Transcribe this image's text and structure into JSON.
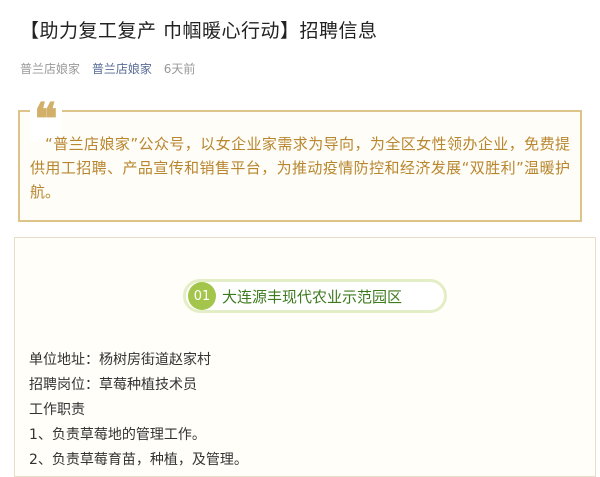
{
  "article": {
    "title": "【助力复工复产 巾帼暖心行动】招聘信息",
    "meta": {
      "author": "普兰店娘家",
      "account": "普兰店娘家",
      "time": "6天前"
    }
  },
  "quote": {
    "mark": "❝",
    "text": "“普兰店娘家”公众号，以女企业家需求为导向，为全区女性领办企业，免费提供用工招聘、产品宣传和销售平台，为推动疫情防控和经济发展“双胜利”温暖护航。"
  },
  "section": {
    "number": "01",
    "name": "大连源丰现代农业示范园区",
    "lines": [
      "单位地址：杨树房街道赵家村",
      "招聘岗位：草莓种植技术员",
      "工作职责",
      "1、负责草莓地的管理工作。",
      "2、负责草莓育苗，种植，及管理。"
    ]
  },
  "colors": {
    "quote_border": "#dcc48a",
    "quote_text": "#b8862f",
    "badge_accent": "#a4c54c",
    "badge_text": "#3d7a1e",
    "link": "#576b95"
  }
}
